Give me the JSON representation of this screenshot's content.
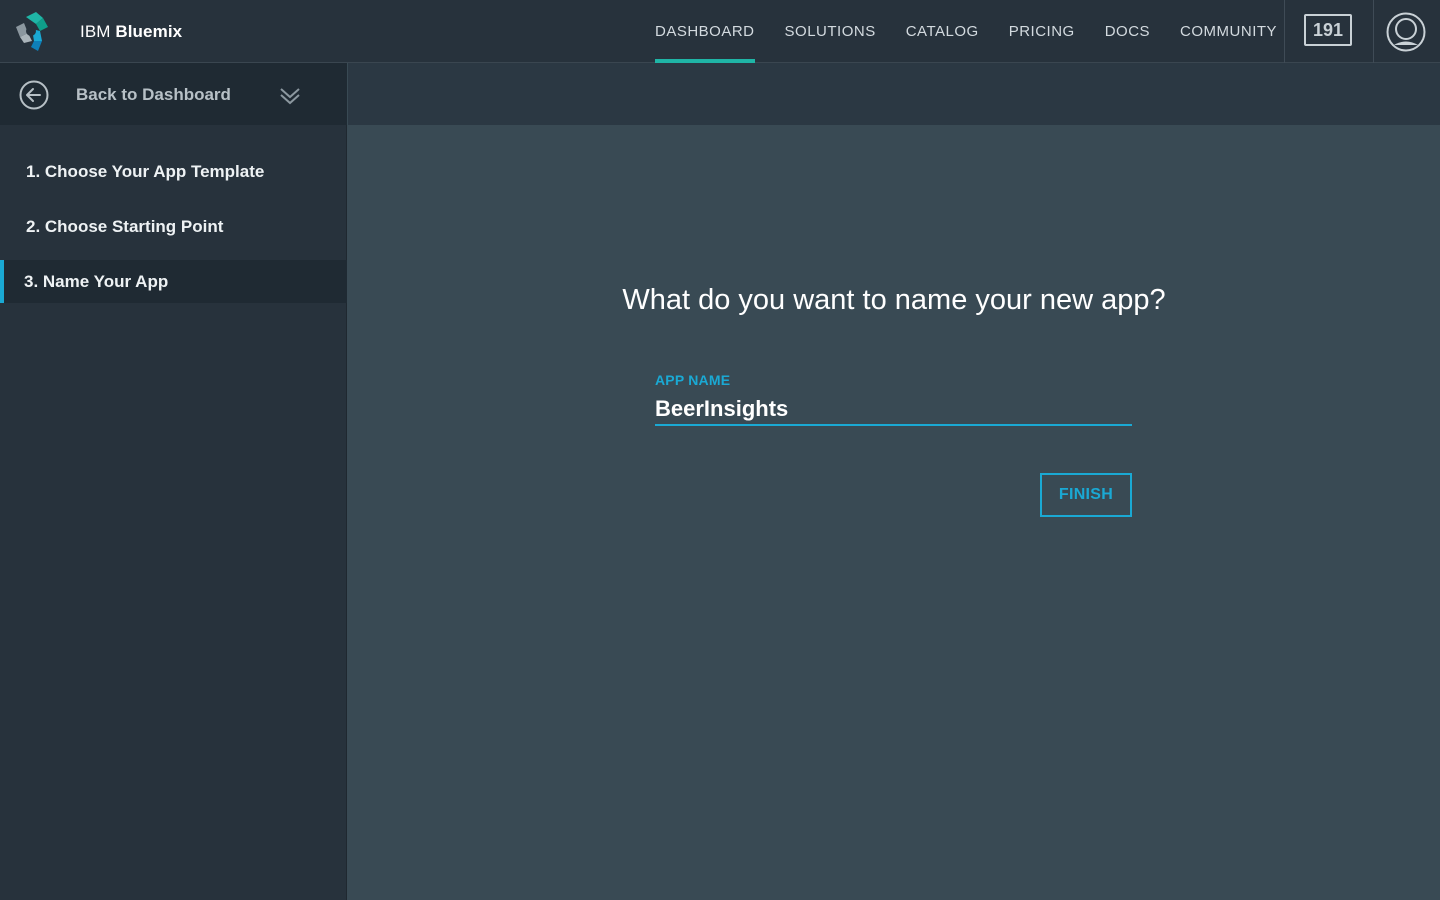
{
  "brand": {
    "name_prefix": "IBM",
    "name_main": "Bluemix",
    "logo_icon": "bluemix-logo-icon"
  },
  "nav": {
    "items": [
      {
        "label": "DASHBOARD",
        "active": true
      },
      {
        "label": "SOLUTIONS",
        "active": false
      },
      {
        "label": "CATALOG",
        "active": false
      },
      {
        "label": "PRICING",
        "active": false
      },
      {
        "label": "DOCS",
        "active": false
      },
      {
        "label": "COMMUNITY",
        "active": false
      }
    ],
    "notification_count": "191",
    "avatar_icon": "user-avatar-icon"
  },
  "sidebar": {
    "back_label": "Back to Dashboard",
    "back_icon": "back-arrow-circle-icon",
    "expand_icon": "chevron-down-double-icon",
    "steps": [
      {
        "label": "1. Choose Your App Template",
        "active": false
      },
      {
        "label": "2. Choose Starting Point",
        "active": false
      },
      {
        "label": "3. Name Your App",
        "active": true
      }
    ]
  },
  "main": {
    "prompt": "What do you want to name your new app?",
    "field_label": "APP NAME",
    "app_name_value": "BeerInsights",
    "finish_label": "FINISH"
  },
  "colors": {
    "accent": "#1aa9d4",
    "nav_active": "#1fb5a6",
    "topbar_bg": "#27323c",
    "content_bg": "#394a54"
  }
}
